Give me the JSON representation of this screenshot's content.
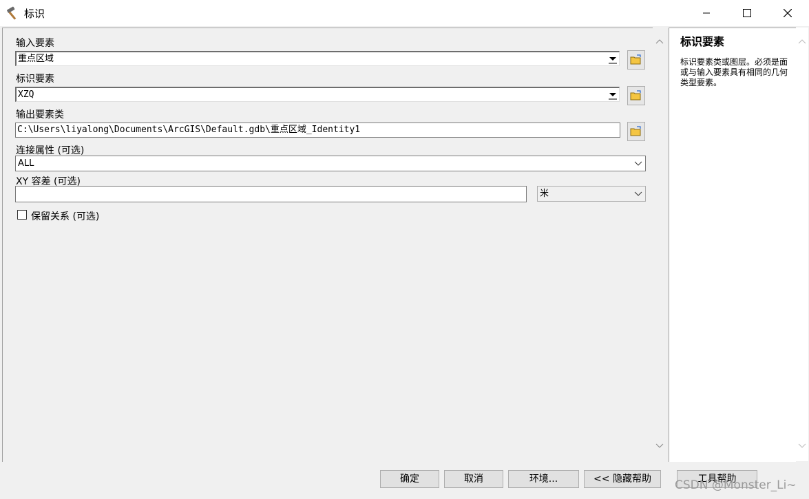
{
  "window": {
    "title": "标识"
  },
  "form": {
    "input_features": {
      "label": "输入要素",
      "value": "重点区域"
    },
    "identity_features": {
      "label": "标识要素",
      "value": "XZQ"
    },
    "output_feature_class": {
      "label": "输出要素类",
      "value": "C:\\Users\\liyalong\\Documents\\ArcGIS\\Default.gdb\\重点区域_Identity1"
    },
    "join_attributes": {
      "label": "连接属性 (可选)",
      "value": "ALL"
    },
    "xy_tolerance": {
      "label": "XY 容差 (可选)",
      "value": "",
      "unit": "米"
    },
    "keep_relationships": {
      "label": "保留关系 (可选)",
      "checked": false
    }
  },
  "help": {
    "title": "标识要素",
    "body": "标识要素类或图层。必须是面或与输入要素具有相同的几何类型要素。"
  },
  "buttons": {
    "ok": "确定",
    "cancel": "取消",
    "environments": "环境...",
    "hide_help": "<< 隐藏帮助",
    "tool_help": "工具帮助"
  },
  "watermark": "CSDN @Monster_Li~",
  "icons": [
    "hammer-icon",
    "minimize-icon",
    "maximize-icon",
    "close-icon",
    "folder-icon",
    "chevron-down-icon",
    "scroll-up-icon",
    "scroll-down-icon"
  ]
}
